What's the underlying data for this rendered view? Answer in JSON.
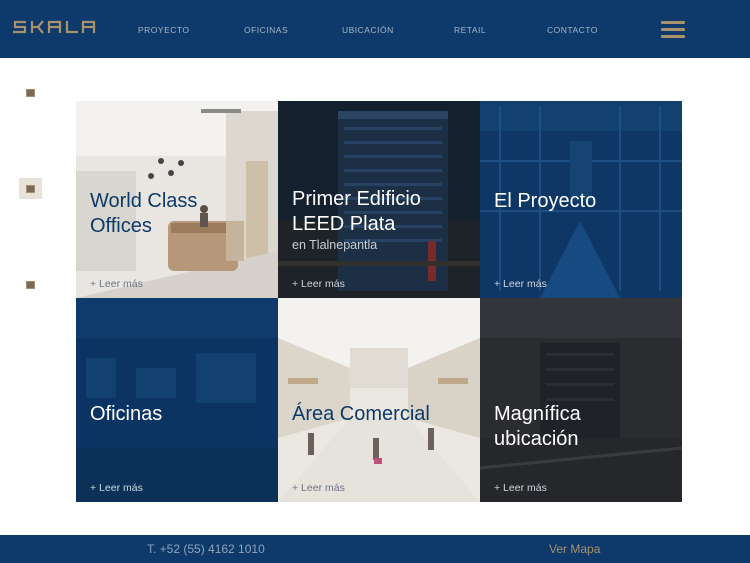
{
  "brand": {
    "name": "SKALA",
    "icon": "skala-logo"
  },
  "nav": {
    "items": [
      {
        "label": "PROYECTO"
      },
      {
        "label": "OFICINAS"
      },
      {
        "label": "UBICACIÓN"
      },
      {
        "label": "RETAIL"
      },
      {
        "label": "CONTACTO"
      }
    ],
    "menu_icon": "hamburger-menu-icon"
  },
  "slider": {
    "dots_count": 3,
    "active_dot": 2
  },
  "tiles": [
    {
      "title": "World Class Offices",
      "title_color": "#0d3a6a",
      "more": "+ Leer más"
    },
    {
      "title": "Primer Edificio LEED Plata",
      "subtitle": "en Tlalnepantla",
      "more": "+ Leer más"
    },
    {
      "title": "El Proyecto",
      "more": "+ Leer más"
    },
    {
      "title": "Oficinas",
      "more": "+ Leer más"
    },
    {
      "title": "Área Comercial",
      "title_color": "#0d3a6a",
      "more": "+ Leer más"
    },
    {
      "title": "Magnífica ubicación",
      "more": "+ Leer más"
    }
  ],
  "footer": {
    "phone": "T. +52 (55) 4162 1010",
    "map_link": "Ver Mapa"
  },
  "colors": {
    "navy": "#0d3a6a",
    "gold": "#a9916c",
    "white": "#ffffff"
  }
}
